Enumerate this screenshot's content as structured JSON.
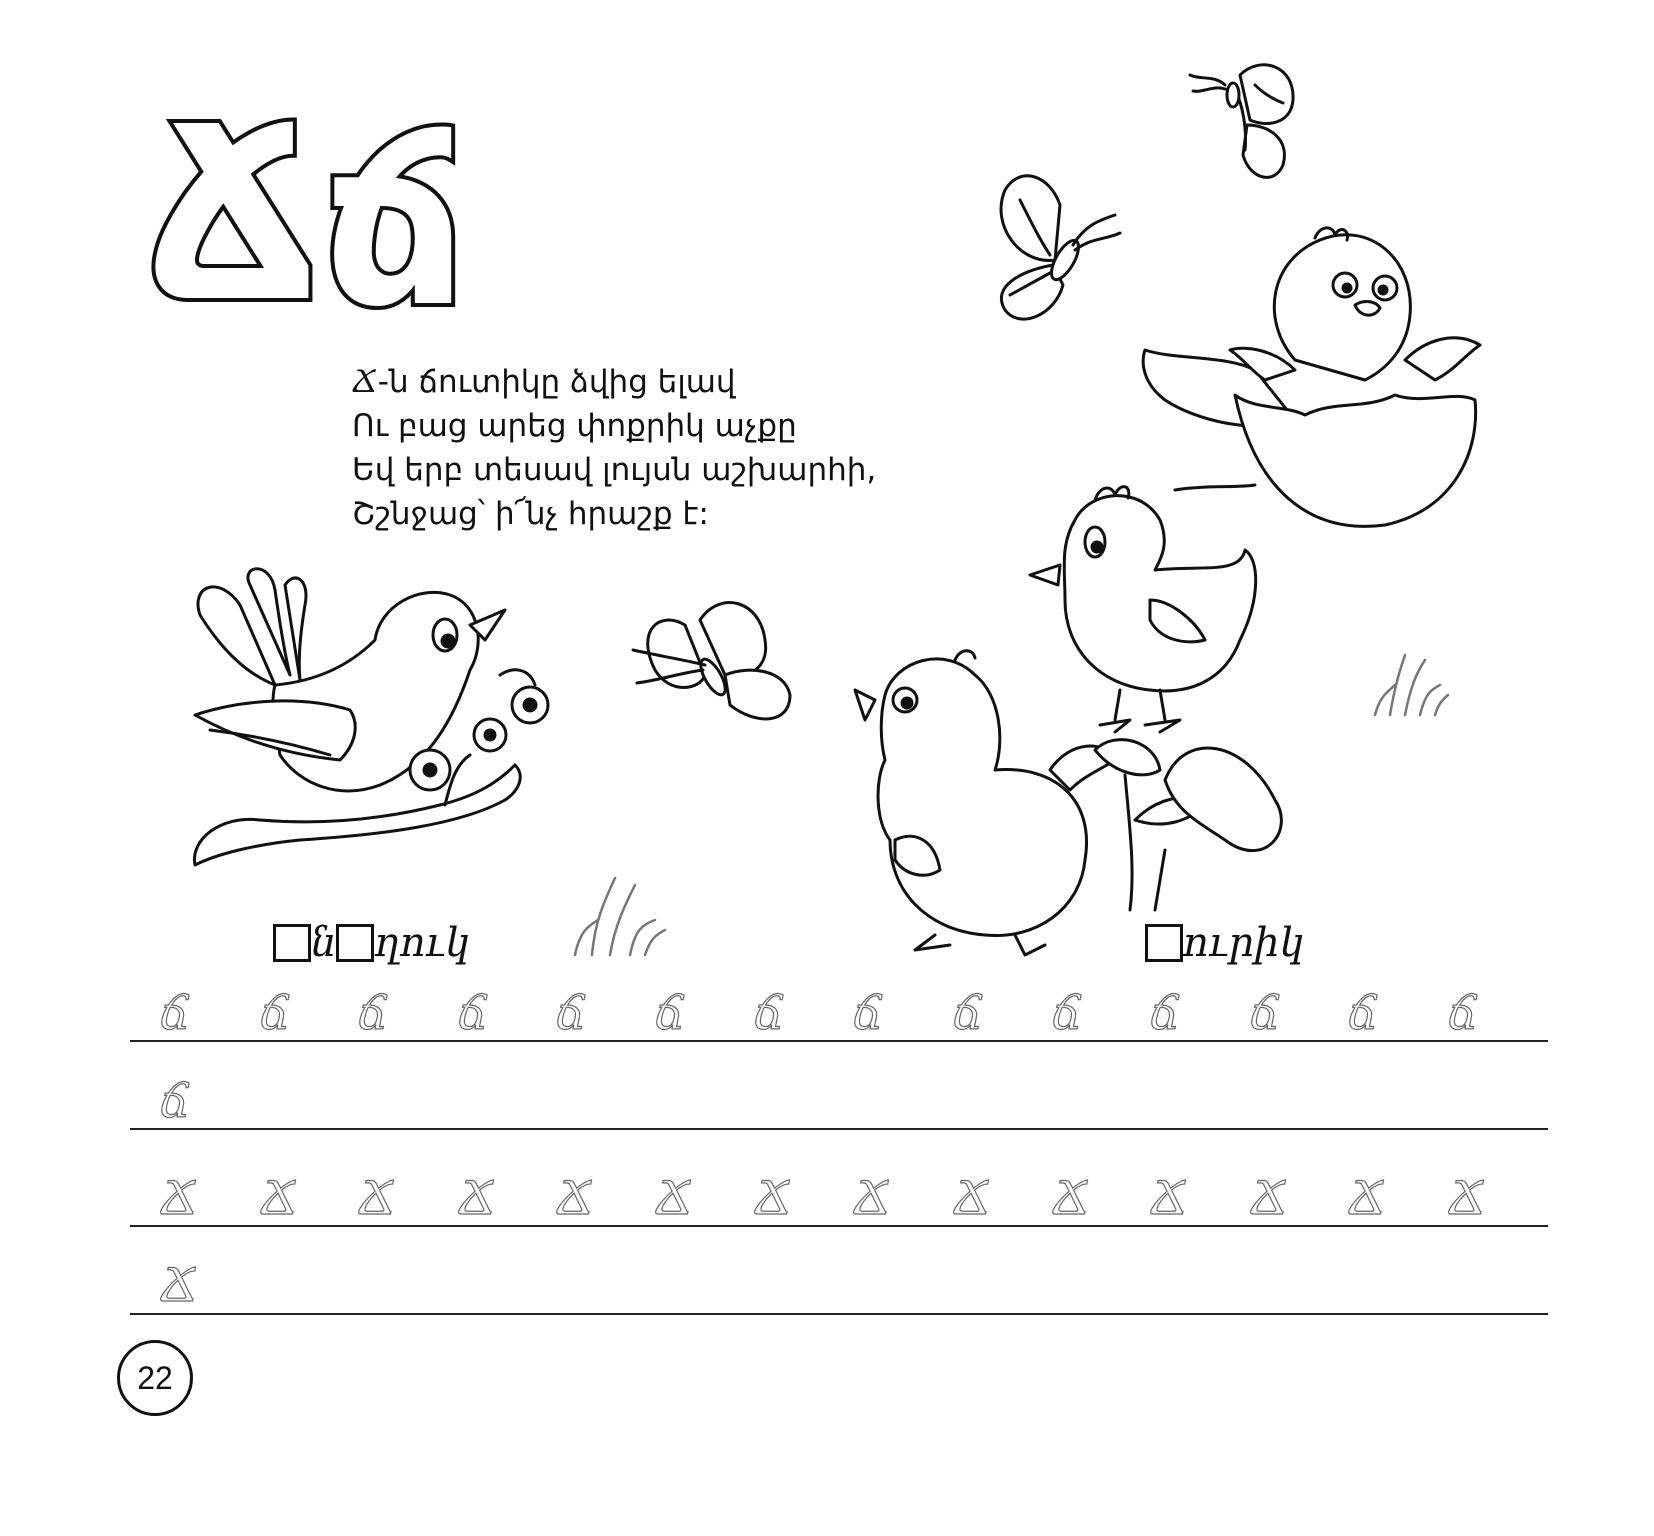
{
  "header": {
    "letter_upper": "Ճ",
    "letter_lower": "ճ"
  },
  "poem": {
    "lines": [
      {
        "lead": "Ճ",
        "rest": "-ն  ճուտիկը ձվից ելավ"
      },
      {
        "lead": "",
        "rest": "Ու բաց արեց փոքրիկ աչքը"
      },
      {
        "lead": "",
        "rest": "Եվ երբ տեսավ լույսն աշխարհի,"
      },
      {
        "lead": "",
        "rest": "Շշնջաց՝ ի՜նչ հրաշք է:"
      }
    ]
  },
  "exercises": {
    "word1": {
      "part1": "ն",
      "part2": "ղուկ"
    },
    "word2": {
      "part1": "ուրիկ"
    }
  },
  "tracing": {
    "row1_glyph": "ճ",
    "row2_glyph": "ճ",
    "row3_glyph": "Ճ",
    "row4_glyph": "Ճ"
  },
  "illustrations": [
    "bird-on-branch",
    "butterfly",
    "butterfly",
    "butterfly",
    "chick-in-egg",
    "chick",
    "chick",
    "grass"
  ],
  "footer": {
    "page_number": "22"
  }
}
